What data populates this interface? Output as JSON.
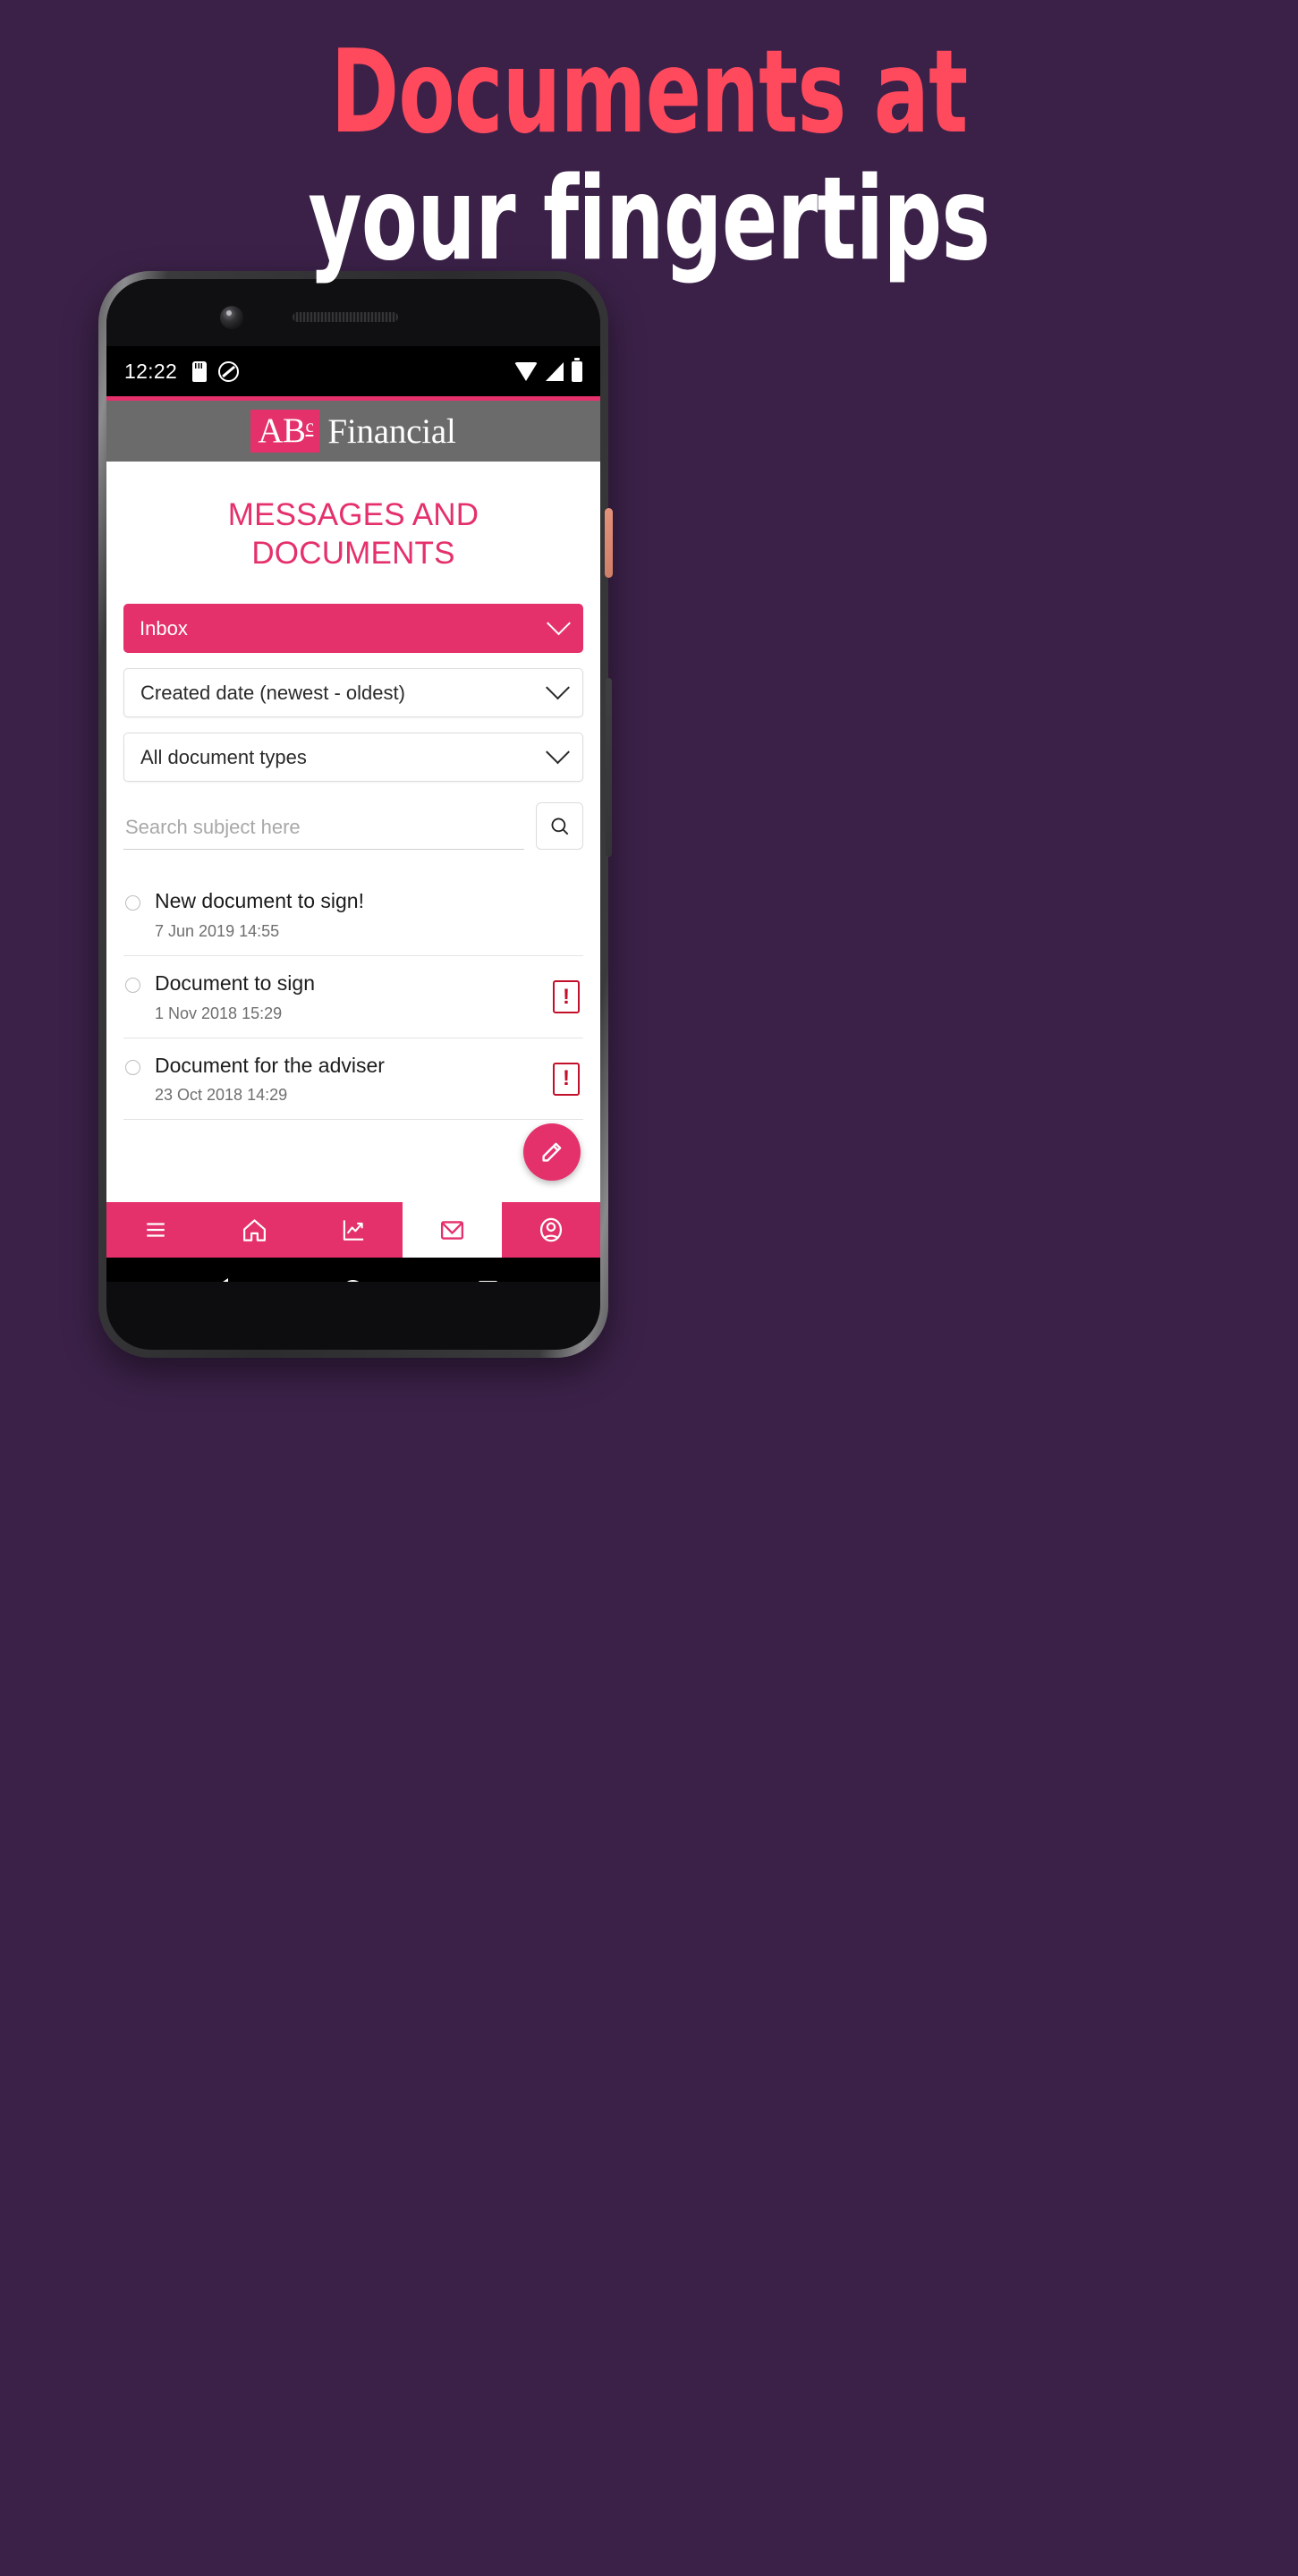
{
  "promo": {
    "line1": "Documents at",
    "line2": "your fingertips",
    "line1_color": "#FF4A5E",
    "line2_color": "#FFFFFF",
    "background_color": "#3B2148"
  },
  "status_bar": {
    "clock": "12:22",
    "icons_left": [
      "sd-card-icon",
      "do-not-disturb-icon"
    ],
    "icons_right": [
      "wifi-icon",
      "cellular-signal-icon",
      "battery-icon"
    ]
  },
  "app_header": {
    "logo_mark": "AB",
    "logo_mark_sup": "c",
    "logo_word": "Financial",
    "accent_color": "#E5316B",
    "bar_color": "#6b6b6b"
  },
  "main": {
    "page_title": "MESSAGES AND DOCUMENTS",
    "filters": [
      {
        "name": "folder",
        "value": "Inbox",
        "style": "primary"
      },
      {
        "name": "sort",
        "value": "Created date (newest - oldest)",
        "style": "secondary"
      },
      {
        "name": "document-type",
        "value": "All document types",
        "style": "secondary"
      }
    ],
    "search": {
      "placeholder": "Search subject here",
      "value": "",
      "button_icon": "search-icon"
    },
    "messages": [
      {
        "subject": "New document to sign!",
        "date": "7 Jun 2019 14:55",
        "alert": ""
      },
      {
        "subject": "Document to sign",
        "date": "1 Nov 2018 15:29",
        "alert": "!"
      },
      {
        "subject": "Document for the adviser",
        "date": "23 Oct 2018 14:29",
        "alert": "!"
      }
    ],
    "compose_fab_icon": "pencil-icon"
  },
  "bottom_nav": [
    {
      "icon": "menu-icon",
      "label": "Menu",
      "active": false
    },
    {
      "icon": "home-icon",
      "label": "Home",
      "active": false
    },
    {
      "icon": "chart-trend-icon",
      "label": "Performance",
      "active": false
    },
    {
      "icon": "mail-icon",
      "label": "Messages",
      "active": true
    },
    {
      "icon": "account-icon",
      "label": "Account",
      "active": false
    }
  ],
  "android_nav": [
    {
      "icon": "back-icon",
      "label": "Back"
    },
    {
      "icon": "home-circle-icon",
      "label": "Home"
    },
    {
      "icon": "recents-square-icon",
      "label": "Recents"
    }
  ]
}
